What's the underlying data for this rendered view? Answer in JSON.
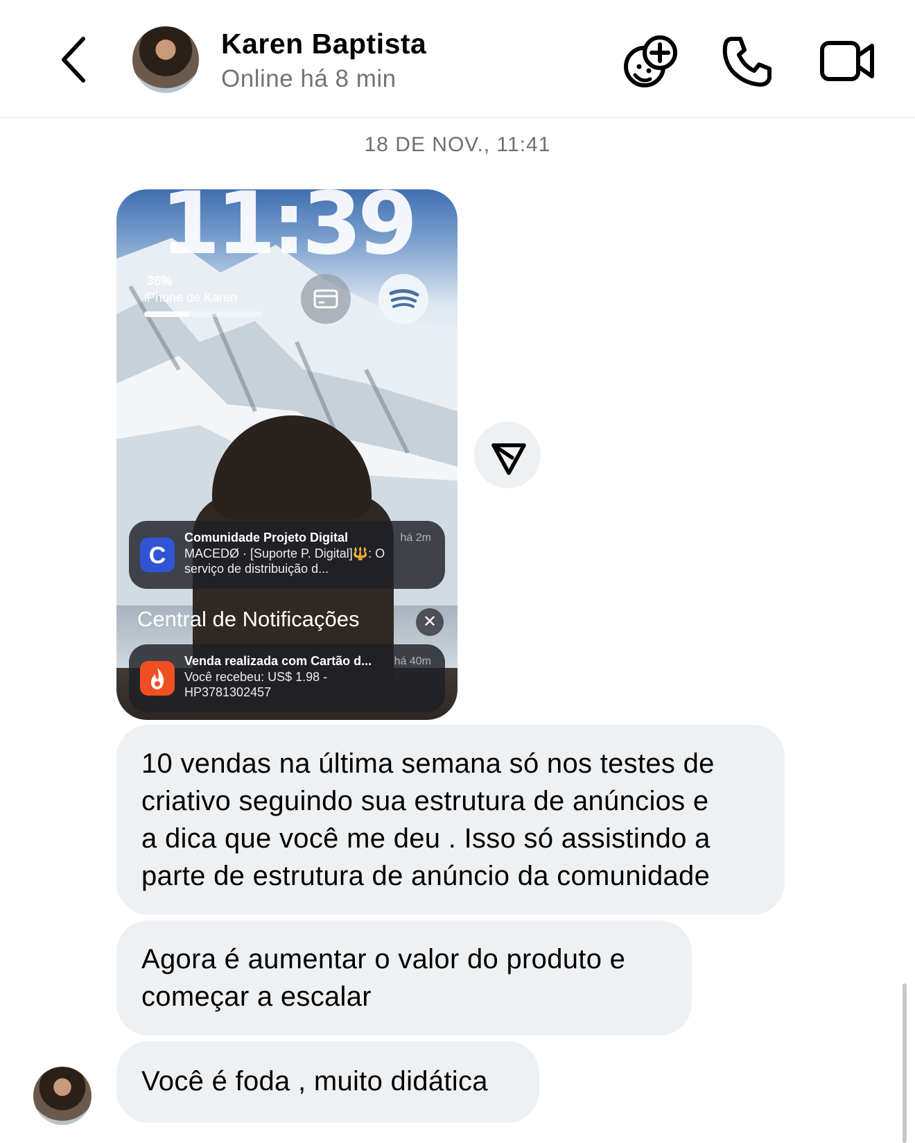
{
  "header": {
    "title": "Karen Baptista",
    "subtitle": "Online há 8 min",
    "icons": [
      "back-arrow-icon",
      "add-emoji-icon",
      "phone-icon",
      "video-camera-icon"
    ]
  },
  "conversation": {
    "date_label": "18 DE NOV., 11:41",
    "image": {
      "clock": "11:39",
      "battery": "36%",
      "device_name": "iPhone de Karen",
      "device_battery_fraction": 0.36,
      "notification_1": {
        "app": "Comunidade Projeto Digital",
        "time": "há 2m",
        "body_line1": "MACEDØ · [Suporte P. Digital]🔱: O",
        "body_line2": "serviço de distribuição d...",
        "icon": "community-c-icon"
      },
      "notification_center_title": "Central de Notificações",
      "notification_2": {
        "app": "Venda realizada com Cartão d...",
        "time": "há 40m",
        "body_line1": "Você recebeu: US$ 1.98 -",
        "body_line2": "HP3781302457",
        "icon": "hotmart-flame-icon"
      }
    },
    "messages": [
      {
        "lines": [
          "10 vendas na última semana só nos testes de",
          "criativo seguindo sua estrutura de anúncios e",
          "a dica que você me deu . Isso só assistindo a",
          "parte de estrutura de anúncio da comunidade"
        ]
      },
      {
        "lines": [
          "Agora é aumentar o valor do produto e",
          "começar a escalar"
        ]
      },
      {
        "lines": [
          "Você é foda , muito didática"
        ]
      }
    ]
  },
  "colors": {
    "bubble": "#eff0f2",
    "subtitle": "#737373",
    "community_icon": "#2f55d4",
    "hotmart_icon": "#f04e23"
  }
}
